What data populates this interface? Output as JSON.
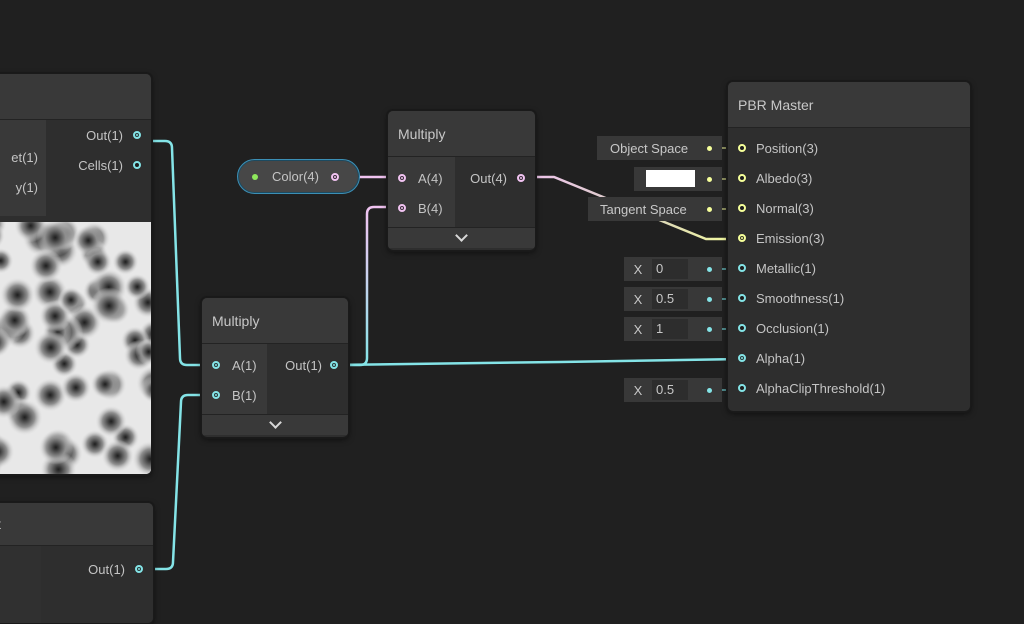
{
  "graph": {
    "colors": {
      "background": "#202020",
      "edge_float": "#84e4e7",
      "edge_vector4": "#f1c3f1",
      "edge_vector3": "#f6ff9a",
      "property_border": "#3c8fb5",
      "property_dot": "#8fe85c"
    },
    "voronoi_node": {
      "title": "",
      "inputs": [
        {
          "label": "et(1)"
        },
        {
          "label": "y(1)"
        }
      ],
      "outputs": [
        {
          "label": "Out(1)",
          "port": "port-connected-icon"
        },
        {
          "label": "Cells(1)",
          "port": "port-empty-icon"
        }
      ],
      "preview": "voronoi-noise-preview"
    },
    "bottom_node": {
      "title": "t",
      "outputs": [
        {
          "label": "Out(1)"
        }
      ]
    },
    "multiply_1": {
      "title": "Multiply",
      "inputs": [
        {
          "label": "A(1)"
        },
        {
          "label": "B(1)"
        }
      ],
      "outputs": [
        {
          "label": "Out(1)"
        }
      ],
      "expand_icon": "chevron-down-icon"
    },
    "multiply_2": {
      "title": "Multiply",
      "inputs": [
        {
          "label": "A(4)"
        },
        {
          "label": "B(4)"
        }
      ],
      "outputs": [
        {
          "label": "Out(4)"
        }
      ],
      "expand_icon": "chevron-down-icon"
    },
    "color_property": {
      "label": "Color(4)"
    },
    "pbr_master": {
      "title": "PBR Master",
      "inputs": [
        {
          "label": "Position(3)",
          "default": "Object Space"
        },
        {
          "label": "Albedo(3)",
          "default_color": "#FFFFFF"
        },
        {
          "label": "Normal(3)",
          "default": "Tangent Space"
        },
        {
          "label": "Emission(3)"
        },
        {
          "label": "Metallic(1)",
          "axis": "X",
          "value": "0"
        },
        {
          "label": "Smoothness(1)",
          "axis": "X",
          "value": "0.5"
        },
        {
          "label": "Occlusion(1)",
          "axis": "X",
          "value": "1"
        },
        {
          "label": "Alpha(1)"
        },
        {
          "label": "AlphaClipThreshold(1)",
          "axis": "X",
          "value": "0.5"
        }
      ]
    }
  }
}
